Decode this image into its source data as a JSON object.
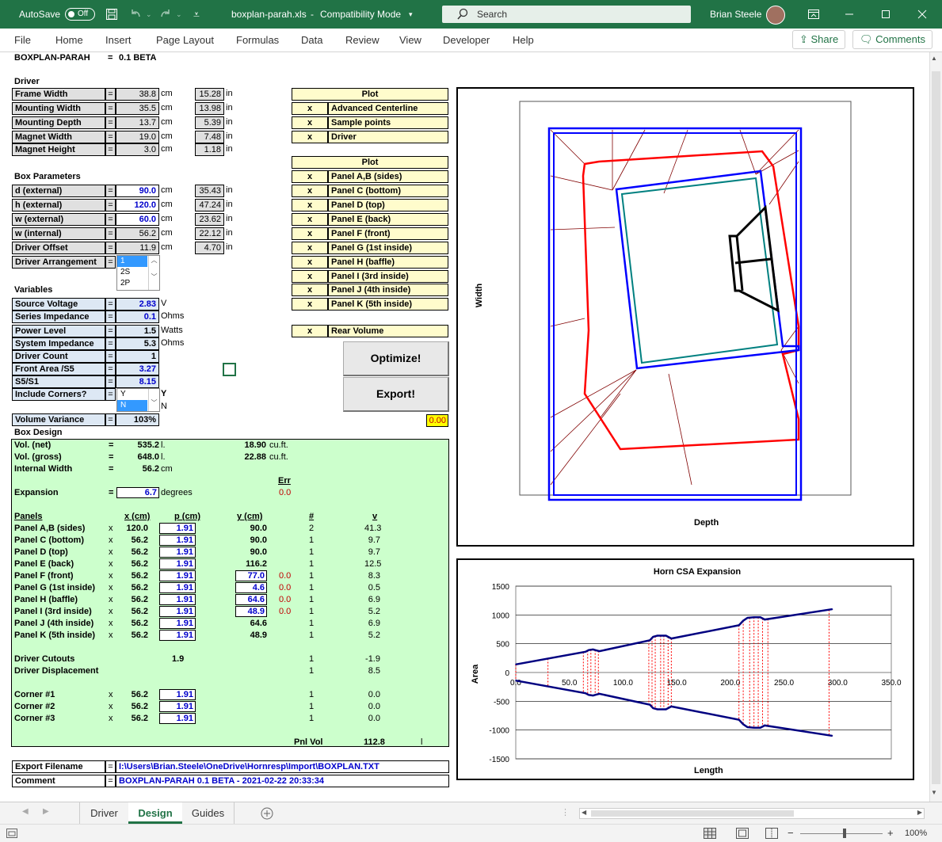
{
  "titlebar": {
    "autosave": "AutoSave",
    "autosave_state": "Off",
    "filename": "boxplan-parah.xls",
    "separator": "-",
    "mode": "Compatibility Mode",
    "search": "Search",
    "user": "Brian Steele",
    "bg_color": "#217346"
  },
  "menu": {
    "items": [
      "File",
      "Home",
      "Insert",
      "Page Layout",
      "Formulas",
      "Data",
      "Review",
      "View",
      "Developer",
      "Help"
    ],
    "share": "Share",
    "comments": "Comments"
  },
  "header": {
    "title": "BOXPLAN-PARAH",
    "eq": "=",
    "version": "0.1 BETA"
  },
  "driver": {
    "heading": "Driver",
    "rows": [
      {
        "label": "Frame Width",
        "eq": "=",
        "value": "38.8",
        "unit": "cm",
        "in_value": "15.28",
        "in_unit": "in"
      },
      {
        "label": "Mounting Width",
        "eq": "=",
        "value": "35.5",
        "unit": "cm",
        "in_value": "13.98",
        "in_unit": "in"
      },
      {
        "label": "Mounting Depth",
        "eq": "=",
        "value": "13.7",
        "unit": "cm",
        "in_value": "5.39",
        "in_unit": "in"
      },
      {
        "label": "Magnet Width",
        "eq": "=",
        "value": "19.0",
        "unit": "cm",
        "in_value": "7.48",
        "in_unit": "in"
      },
      {
        "label": "Magnet Height",
        "eq": "=",
        "value": "3.0",
        "unit": "cm",
        "in_value": "1.18",
        "in_unit": "in"
      }
    ]
  },
  "box": {
    "heading": "Box Parameters",
    "rows": [
      {
        "label": "d (external)",
        "eq": "=",
        "value": "90.0",
        "unit": "cm",
        "in_value": "35.43",
        "in_unit": "in"
      },
      {
        "label": "h (external)",
        "eq": "=",
        "value": "120.0",
        "unit": "cm",
        "in_value": "47.24",
        "in_unit": "in"
      },
      {
        "label": "w (external)",
        "eq": "=",
        "value": "60.0",
        "unit": "cm",
        "in_value": "23.62",
        "in_unit": "in"
      },
      {
        "label": "w (internal)",
        "eq": "=",
        "value": "56.2",
        "unit": "cm",
        "in_value": "22.12",
        "in_unit": "in"
      },
      {
        "label": "Driver Offset",
        "eq": "=",
        "value": "11.9",
        "unit": "cm",
        "in_value": "4.70",
        "in_unit": "in"
      }
    ],
    "arrangement": {
      "label": "Driver Arrangement",
      "eq": "=",
      "options": [
        "1",
        "2S",
        "2P"
      ],
      "selected": "1"
    }
  },
  "variables": {
    "heading": "Variables",
    "rows": [
      {
        "label": "Source Voltage",
        "eq": "=",
        "value": "2.83",
        "unit": "V"
      },
      {
        "label": "Series Impedance",
        "eq": "=",
        "value": "0.1",
        "unit": "Ohms"
      },
      {
        "label": "Power Level",
        "eq": "=",
        "value": "1.5",
        "unit": "Watts"
      },
      {
        "label": "System Impedance",
        "eq": "=",
        "value": "5.3",
        "unit": "Ohms"
      },
      {
        "label": "Driver Count",
        "eq": "=",
        "value": "1",
        "unit": ""
      },
      {
        "label": "Front Area /S5",
        "eq": "=",
        "value": "3.27",
        "unit": ""
      },
      {
        "label": "S5/S1",
        "eq": "=",
        "value": "8.15",
        "unit": ""
      }
    ],
    "corners": {
      "label": "Include Corners?",
      "eq": "=",
      "options": [
        "Y",
        "N"
      ],
      "selected": "N",
      "side_y": "Y",
      "side_n": "N"
    },
    "variance": {
      "label": "Volume Variance",
      "eq": "=",
      "value": "103%"
    }
  },
  "plot1": {
    "header": "Plot",
    "rows": [
      {
        "x": "x",
        "label": "Advanced Centerline"
      },
      {
        "x": "x",
        "label": "Sample points"
      },
      {
        "x": "x",
        "label": "Driver"
      }
    ]
  },
  "plot2": {
    "header": "Plot",
    "rows": [
      {
        "x": "x",
        "label": "Panel A,B (sides)"
      },
      {
        "x": "x",
        "label": "Panel C (bottom)"
      },
      {
        "x": "x",
        "label": "Panel D (top)"
      },
      {
        "x": "x",
        "label": "Panel E (back)"
      },
      {
        "x": "x",
        "label": "Panel F (front)"
      },
      {
        "x": "x",
        "label": "Panel G (1st inside)"
      },
      {
        "x": "x",
        "label": "Panel H (baffle)"
      },
      {
        "x": "x",
        "label": "Panel I (3rd inside)"
      },
      {
        "x": "x",
        "label": "Panel J (4th inside)"
      },
      {
        "x": "x",
        "label": "Panel K (5th inside)"
      }
    ]
  },
  "rear": {
    "x": "x",
    "label": "Rear Volume"
  },
  "buttons": {
    "optimize": "Optimize!",
    "export": "Export!"
  },
  "error_value": "0.00",
  "design": {
    "heading": "Box Design",
    "vol_net": {
      "label": "Vol. (net)",
      "eq": "=",
      "l": "535.2",
      "lu": "l.",
      "cf": "18.90",
      "cfu": "cu.ft."
    },
    "vol_gross": {
      "label": "Vol. (gross)",
      "eq": "=",
      "l": "648.0",
      "lu": "l.",
      "cf": "22.88",
      "cfu": "cu.ft."
    },
    "internal": {
      "label": "Internal Width",
      "eq": "=",
      "value": "56.2",
      "unit": "cm"
    },
    "err_header": "Err",
    "err_value": "0.0",
    "expansion": {
      "label": "Expansion",
      "eq": "=",
      "value": "6.7",
      "unit": "degrees"
    },
    "cols": {
      "panels": "Panels",
      "x": "x (cm)",
      "p": "p (cm)",
      "y": "y (cm)",
      "n": "#",
      "v": "v"
    },
    "panels": [
      {
        "name": "Panel A,B (sides)",
        "x": "x",
        "xv": "120.0",
        "p": "1.91",
        "y": "90.0",
        "yin": false,
        "err": "",
        "n": "2",
        "v": "41.3"
      },
      {
        "name": "Panel C (bottom)",
        "x": "x",
        "xv": "56.2",
        "p": "1.91",
        "y": "90.0",
        "yin": false,
        "err": "",
        "n": "1",
        "v": "9.7"
      },
      {
        "name": "Panel D (top)",
        "x": "x",
        "xv": "56.2",
        "p": "1.91",
        "y": "90.0",
        "yin": false,
        "err": "",
        "n": "1",
        "v": "9.7"
      },
      {
        "name": "Panel E (back)",
        "x": "x",
        "xv": "56.2",
        "p": "1.91",
        "y": "116.2",
        "yin": false,
        "err": "",
        "n": "1",
        "v": "12.5"
      },
      {
        "name": "Panel F (front)",
        "x": "x",
        "xv": "56.2",
        "p": "1.91",
        "y": "77.0",
        "yin": true,
        "err": "0.0",
        "n": "1",
        "v": "8.3"
      },
      {
        "name": "Panel G (1st inside)",
        "x": "x",
        "xv": "56.2",
        "p": "1.91",
        "y": "4.6",
        "yin": true,
        "err": "0.0",
        "n": "1",
        "v": "0.5"
      },
      {
        "name": "Panel H (baffle)",
        "x": "x",
        "xv": "56.2",
        "p": "1.91",
        "y": "64.6",
        "yin": true,
        "err": "0.0",
        "n": "1",
        "v": "6.9"
      },
      {
        "name": "Panel I (3rd inside)",
        "x": "x",
        "xv": "56.2",
        "p": "1.91",
        "y": "48.9",
        "yin": true,
        "err": "0.0",
        "n": "1",
        "v": "5.2"
      },
      {
        "name": "Panel J (4th inside)",
        "x": "x",
        "xv": "56.2",
        "p": "1.91",
        "y": "64.6",
        "yin": false,
        "err": "",
        "n": "1",
        "v": "6.9"
      },
      {
        "name": "Panel K (5th inside)",
        "x": "x",
        "xv": "56.2",
        "p": "1.91",
        "y": "48.9",
        "yin": false,
        "err": "",
        "n": "1",
        "v": "5.2"
      }
    ],
    "cutouts": {
      "label": "Driver Cutouts",
      "value": "1.9",
      "n": "1",
      "v": "-1.9"
    },
    "displacement": {
      "label": "Driver Displacement",
      "n": "1",
      "v": "8.5"
    },
    "corners": [
      {
        "name": "Corner #1",
        "x": "x",
        "xv": "56.2",
        "p": "1.91",
        "n": "1",
        "v": "0.0"
      },
      {
        "name": "Corner #2",
        "x": "x",
        "xv": "56.2",
        "p": "1.91",
        "n": "1",
        "v": "0.0"
      },
      {
        "name": "Corner #3",
        "x": "x",
        "xv": "56.2",
        "p": "1.91",
        "n": "1",
        "v": "0.0"
      }
    ],
    "pnl_vol": {
      "label": "Pnl Vol",
      "value": "112.8",
      "unit": "l"
    }
  },
  "export": {
    "label": "Export Filename",
    "eq": "=",
    "value": "I:\\Users\\Brian.Steele\\OneDrive\\Hornresp\\Import\\BOXPLAN.TXT"
  },
  "comment": {
    "label": "Comment",
    "eq": "=",
    "value": "BOXPLAN-PARAH 0.1 BETA - 2021-02-22 20:33:34"
  },
  "diagram": {
    "ylabel": "Width",
    "xlabel": "Depth"
  },
  "chart_data": {
    "type": "line",
    "title": "Horn CSA Expansion",
    "xlabel": "Length",
    "ylabel": "Area",
    "xlim": [
      0,
      350
    ],
    "ylim": [
      -1500,
      1500
    ],
    "x_ticks": [
      "0.0",
      "50.0",
      "100.0",
      "150.0",
      "200.0",
      "250.0",
      "300.0",
      "350.0"
    ],
    "y_ticks": [
      "1500",
      "1000",
      "500",
      "0",
      "-500",
      "-1000",
      "-1500"
    ],
    "series": [
      {
        "color": "#000080",
        "x": [
          0,
          65,
          68,
          72,
          75,
          78,
          125,
          128,
          132,
          140,
          145,
          208,
          212,
          216,
          222,
          228,
          232,
          295
        ],
        "y": [
          140,
          360,
          390,
          400,
          385,
          370,
          560,
          620,
          640,
          640,
          590,
          820,
          900,
          950,
          960,
          960,
          920,
          1100
        ]
      }
    ],
    "sample_x": [
      0,
      30,
      63,
      67,
      70,
      74,
      77,
      124,
      127,
      130,
      135,
      138,
      142,
      145,
      208,
      212,
      218,
      222,
      226,
      230,
      235,
      292
    ]
  }
}
